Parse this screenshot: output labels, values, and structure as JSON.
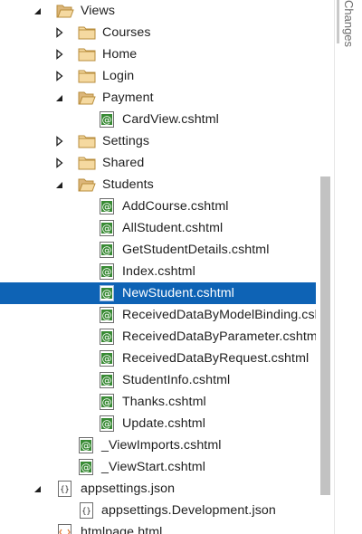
{
  "tree": {
    "views_label": "Views",
    "courses_label": "Courses",
    "home_label": "Home",
    "login_label": "Login",
    "payment_label": "Payment",
    "cardview_label": "CardView.cshtml",
    "settings_label": "Settings",
    "shared_label": "Shared",
    "students_label": "Students",
    "students_files": [
      "AddCourse.cshtml",
      "AllStudent.cshtml",
      "GetStudentDetails.cshtml",
      "Index.cshtml",
      "NewStudent.cshtml",
      "ReceivedDataByModelBinding.cshtml",
      "ReceivedDataByParameter.cshtml",
      "ReceivedDataByRequest.cshtml",
      "StudentInfo.cshtml",
      "Thanks.cshtml",
      "Update.cshtml"
    ],
    "viewimports_label": "_ViewImports.cshtml",
    "viewstart_label": "_ViewStart.cshtml",
    "appsettings_label": "appsettings.json",
    "appsettings_dev_label": "appsettings.Development.json",
    "htmlpage_label": "htmlpage.html",
    "selected_item": "NewStudent.cshtml"
  },
  "side_tab": {
    "label": "Changes"
  },
  "colors": {
    "selection": "#0e63b5",
    "folder": "#dcb67a",
    "razor_icon": "#388a34"
  }
}
